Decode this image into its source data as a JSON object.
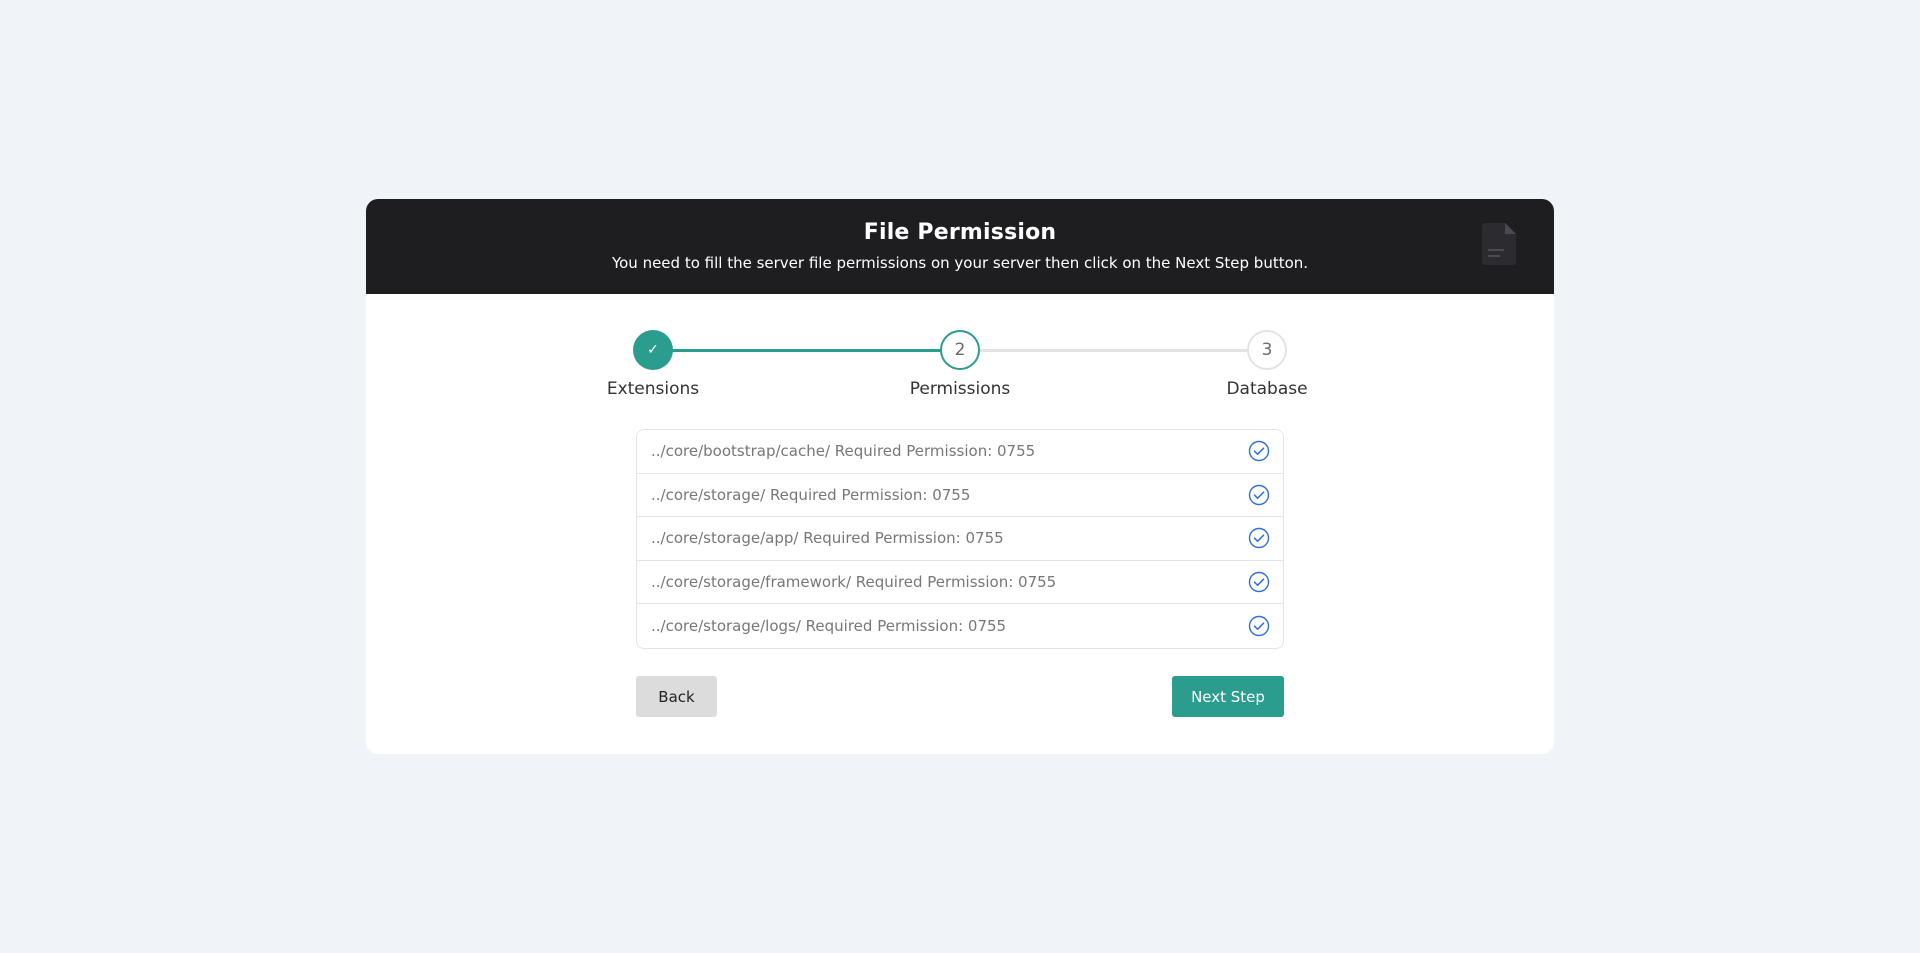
{
  "header": {
    "title": "File Permission",
    "subtitle": "You need to fill the server file permissions on your server then click on the Next Step button.",
    "icon": "document-icon"
  },
  "steps": [
    {
      "number": "✓",
      "label": "Extensions",
      "status": "completed"
    },
    {
      "number": "2",
      "label": "Permissions",
      "status": "active"
    },
    {
      "number": "3",
      "label": "Database",
      "status": "pending"
    }
  ],
  "permissions": [
    {
      "text": "../core/bootstrap/cache/ Required Permission: 0755",
      "ok": true
    },
    {
      "text": "../core/storage/ Required Permission: 0755",
      "ok": true
    },
    {
      "text": "../core/storage/app/ Required Permission: 0755",
      "ok": true
    },
    {
      "text": "../core/storage/framework/ Required Permission: 0755",
      "ok": true
    },
    {
      "text": "../core/storage/logs/ Required Permission: 0755",
      "ok": true
    }
  ],
  "buttons": {
    "back_label": "Back",
    "next_label": "Next Step"
  },
  "colors": {
    "accent": "#2a9d8f",
    "header_bg": "#1e1e21",
    "check": "#2f6fd6",
    "page_bg": "#f0f3f8"
  }
}
